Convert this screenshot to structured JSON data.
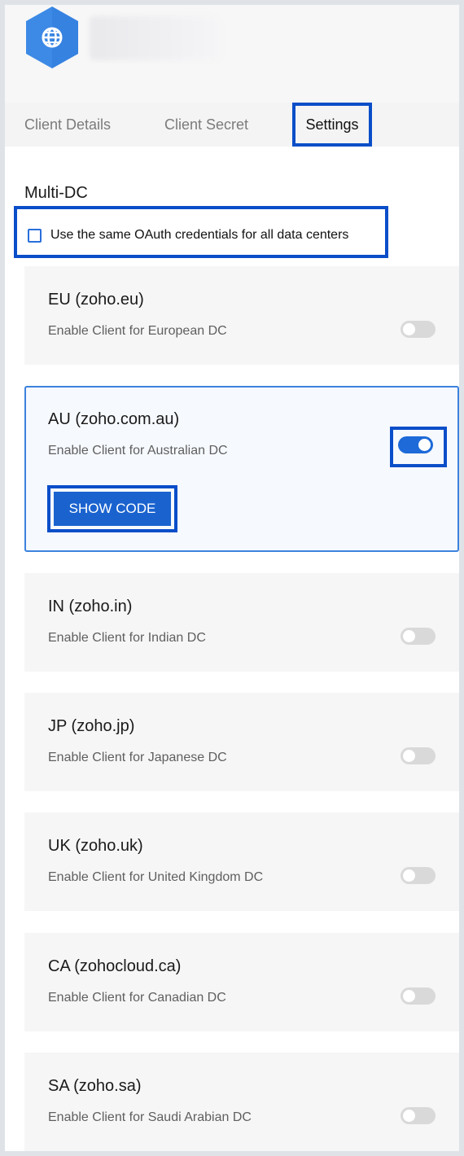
{
  "tabs": [
    {
      "label": "Client Details"
    },
    {
      "label": "Client Secret"
    },
    {
      "label": "Settings",
      "active": true
    }
  ],
  "settings": {
    "section_title": "Multi-DC",
    "same_credentials_label": "Use the same OAuth credentials for all data centers",
    "same_credentials_checked": false,
    "show_code_label": "SHOW CODE"
  },
  "data_centers": [
    {
      "title": "EU (zoho.eu)",
      "description": "Enable Client for European DC",
      "enabled": false
    },
    {
      "title": "AU (zoho.com.au)",
      "description": "Enable Client for Australian DC",
      "enabled": true
    },
    {
      "title": "IN (zoho.in)",
      "description": "Enable Client for Indian DC",
      "enabled": false
    },
    {
      "title": "JP (zoho.jp)",
      "description": "Enable Client for Japanese DC",
      "enabled": false
    },
    {
      "title": "UK (zoho.uk)",
      "description": "Enable Client for United Kingdom DC",
      "enabled": false
    },
    {
      "title": "CA (zohocloud.ca)",
      "description": "Enable Client for Canadian DC",
      "enabled": false
    },
    {
      "title": "SA (zoho.sa)",
      "description": "Enable Client for Saudi Arabian DC",
      "enabled": false
    }
  ],
  "colors": {
    "accent": "#1d6ad8",
    "highlight_border": "#0a4ec9",
    "toggle_off": "#d9d9d9",
    "logo": "#3d8ae6"
  },
  "icons": {
    "app_logo": "globe-hexagon-icon"
  }
}
